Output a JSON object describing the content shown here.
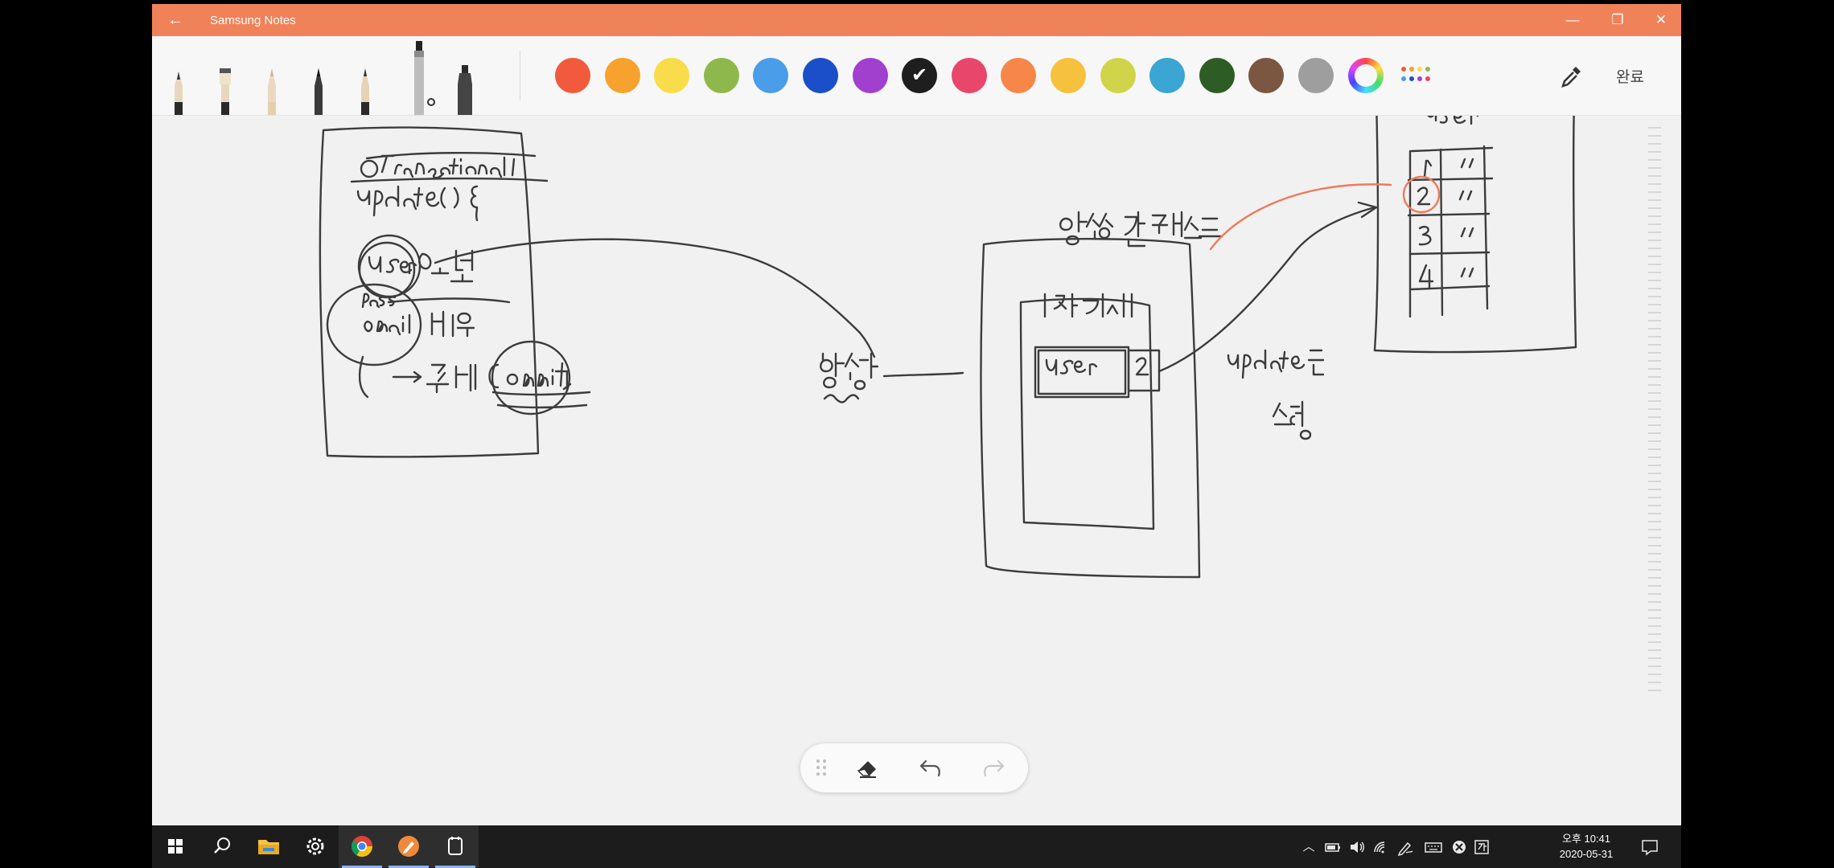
{
  "titlebar": {
    "app_title": "Samsung Notes",
    "back_icon": "←",
    "minimize_icon": "—",
    "restore_icon": "❐",
    "close_icon": "✕"
  },
  "toolbar": {
    "pens": [
      "fountain-pen",
      "calligraphy-brush",
      "brush-pen",
      "pencil",
      "chisel-pen",
      "marker-pen",
      "highlighter"
    ],
    "palette": [
      "#f15a3c",
      "#f7a12e",
      "#f9dc49",
      "#8fb84c",
      "#4a9de8",
      "#1a4fc9",
      "#a13fcf",
      "#1e1e1e",
      "#e8466a",
      "#f78749",
      "#f6c13c",
      "#d0d44a",
      "#3ba5d3",
      "#2e5c25",
      "#7b5640",
      "#9e9e9e"
    ],
    "selected_color": "#1e1e1e",
    "done_label": "완료"
  },
  "taskbar": {
    "time": "오후 10:41",
    "date": "2020-05-31"
  },
  "accent": "#f0825a"
}
